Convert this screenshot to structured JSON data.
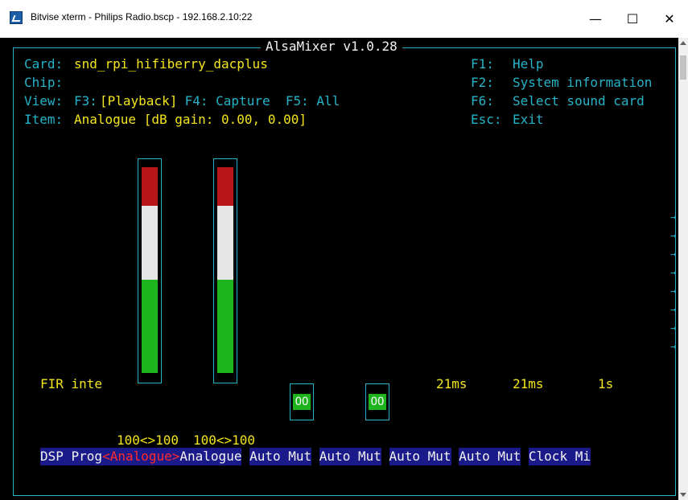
{
  "window": {
    "title": "Bitvise xterm - Philips Radio.bscp - 192.168.2.10:22",
    "minimize_glyph": "—",
    "maximize_glyph": "☐",
    "close_glyph": "✕"
  },
  "mixer": {
    "title": "AlsaMixer v1.0.28",
    "card_label": "Card:",
    "card_value": "snd_rpi_hifiberry_dacplus",
    "chip_label": "Chip:",
    "view_label": "View:",
    "view_f3": "F3:",
    "view_playback": "[Playback]",
    "view_capture": " F4: Capture  F5: All",
    "item_label": "Item:",
    "item_value": "Analogue [dB gain: 0.00, 0.00]"
  },
  "keys": {
    "f1_key": "F1:",
    "f1_text": "Help",
    "f2_key": "F2:",
    "f2_text": "System information",
    "f6_key": "F6:",
    "f6_text": "Select sound card",
    "esc_key": "Esc:",
    "esc_text": "Exit"
  },
  "controls": {
    "fir_label": "FIR inte",
    "switch1_value": "OO",
    "switch2_value": "OO",
    "val_21ms_a": "21ms",
    "val_21ms_b": "21ms",
    "val_1s": "1s",
    "volume1": "100<>100",
    "volume2": "100<>100"
  },
  "bottom_labels": {
    "l0": "DSP Prog",
    "l1_active": "<Analogue>",
    "l2": "Analogue",
    "l3": "Auto Mut",
    "l4": "Auto Mut",
    "l5": "Auto Mut",
    "l6": "Auto Mut",
    "l7": "Clock Mi"
  },
  "gauges": [
    {
      "name": "Analogue left channel",
      "level_percent": 100
    },
    {
      "name": "Analogue right channel",
      "level_percent": 100
    }
  ],
  "overflow_arrows": [
    "→",
    "→",
    "→",
    "→",
    "→",
    "→",
    "→",
    "→"
  ],
  "colors": {
    "cyan": "#26b3c9",
    "yellow": "#f2e51d",
    "red": "#b81717",
    "green": "#1db41d",
    "label_bg": "#1a1a8a"
  }
}
